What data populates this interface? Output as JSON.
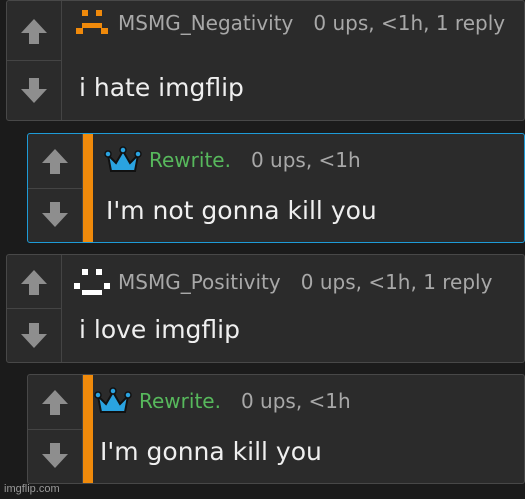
{
  "comments": [
    {
      "username": "MSMG_Negativity",
      "meta": "0 ups, <1h, 1 reply",
      "text": "i hate imgflip",
      "avatar_icon": "frown-face-icon",
      "username_color": "#a8a8a8"
    },
    {
      "username": "Rewrite.",
      "meta": "0 ups, <1h",
      "text": "I'm not gonna kill you",
      "avatar_icon": "crown-icon",
      "username_color": "#57b85c"
    },
    {
      "username": "MSMG_Positivity",
      "meta": "0 ups, <1h, 1 reply",
      "text": "i love imgflip",
      "avatar_icon": "smile-face-icon",
      "username_color": "#a8a8a8"
    },
    {
      "username": "Rewrite.",
      "meta": "0 ups, <1h",
      "text": "I'm gonna kill you",
      "avatar_icon": "crown-icon",
      "username_color": "#57b85c"
    }
  ],
  "colors": {
    "background": "#1b1b1b",
    "card": "#2b2b2b",
    "reply_border": "#1e9bd7",
    "accent_bar": "#f08a0b",
    "vote_arrow": "#8e8e8e",
    "crown_fill": "#2aa3e0",
    "frown_face": "#f08a0b",
    "smile_face": "#ffffff"
  },
  "watermark": "imgflip.com"
}
